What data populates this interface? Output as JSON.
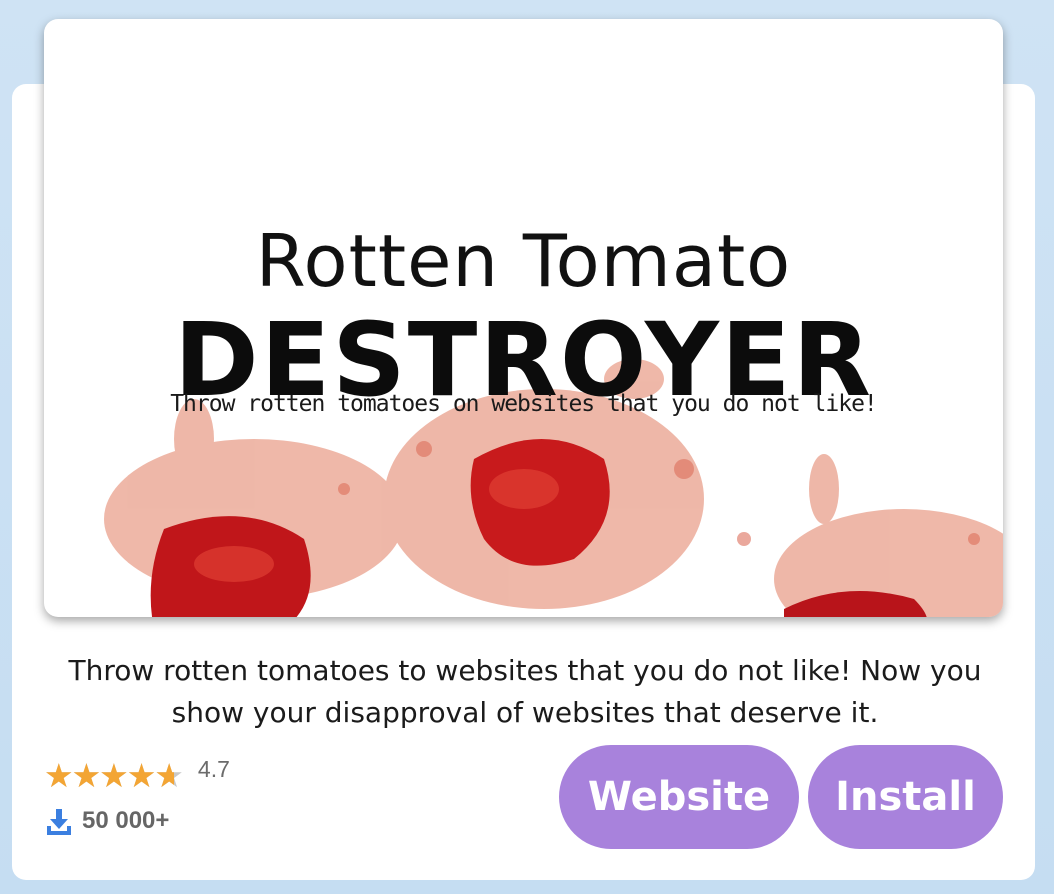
{
  "hero": {
    "title": "Rotten Tomato",
    "subtitle_big": "DESTROYER",
    "tagline": "Throw rotten tomatoes on websites that you do not like!"
  },
  "description": "Throw rotten tomatoes to websites that you do not like! Now you show your disapproval of websites that deserve it.",
  "rating": {
    "value": "4.7",
    "fraction": 0.94,
    "star_color": "#f3a534"
  },
  "downloads": {
    "count": "50 000+"
  },
  "buttons": {
    "website": "Website",
    "install": "Install"
  },
  "colors": {
    "button_bg": "#a882dc",
    "background": "#cfe3f4"
  }
}
